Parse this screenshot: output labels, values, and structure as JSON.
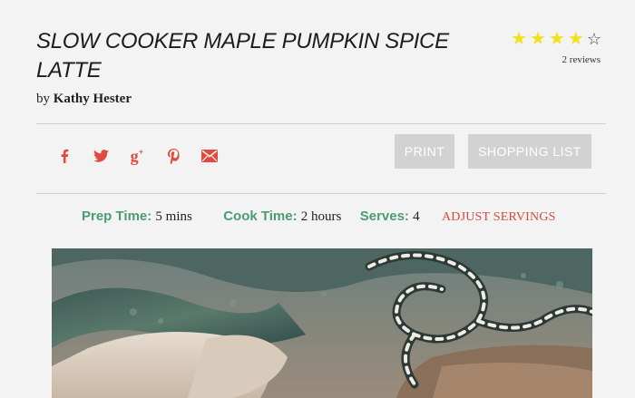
{
  "recipe": {
    "title": "SLOW COOKER MAPLE PUMPKIN SPICE LATTE",
    "byline_prefix": "by",
    "author": "Kathy Hester"
  },
  "rating": {
    "value": 4,
    "max": 5,
    "full_star": "★",
    "empty_star": "☆",
    "reviews_label": "2 reviews",
    "star_color": "#f2e11e"
  },
  "share": {
    "icons": [
      "facebook-icon",
      "twitter-icon",
      "google-plus-icon",
      "pinterest-icon",
      "email-icon"
    ],
    "color": "#e04a3f"
  },
  "actions": {
    "print_label": "PRINT",
    "shopping_list_label": "SHOPPING LIST"
  },
  "times": {
    "prep_label": "Prep Time:",
    "prep_value": "5 mins",
    "cook_label": "Cook Time:",
    "cook_value": "2 hours",
    "serves_label": "Serves:",
    "serves_value": "4",
    "adjust_label": "ADJUST SERVINGS",
    "label_color": "#4a9c73"
  }
}
